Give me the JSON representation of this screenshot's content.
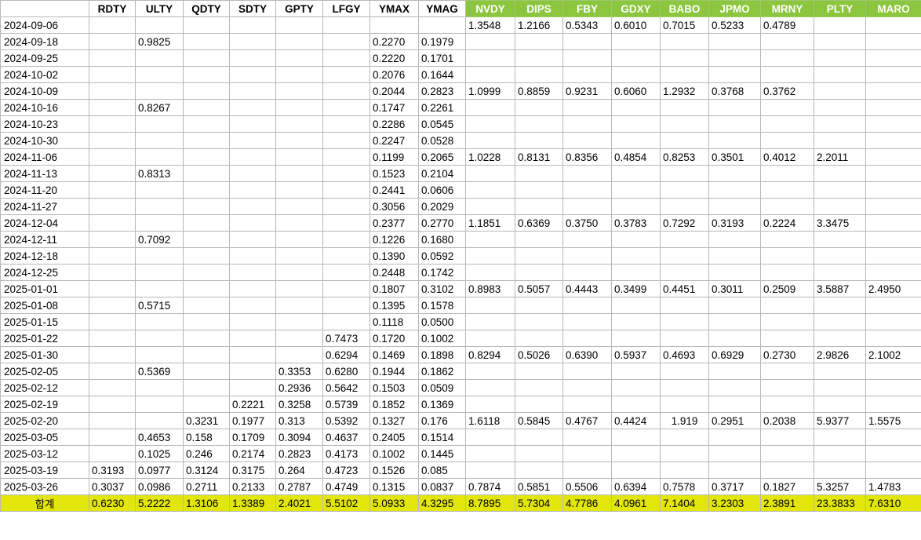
{
  "columns": [
    "",
    "RDTY",
    "ULTY",
    "QDTY",
    "SDTY",
    "GPTY",
    "LFGY",
    "YMAX",
    "YMAG",
    "NVDY",
    "DIPS",
    "FBY",
    "GDXY",
    "BABO",
    "JPMO",
    "MRNY",
    "PLTY",
    "MARO"
  ],
  "rows": [
    [
      "2024-09-06",
      "",
      "",
      "",
      "",
      "",
      "",
      "",
      "",
      "1.3548",
      "1.2166",
      "0.5343",
      "0.6010",
      "0.7015",
      "0.5233",
      "0.4789",
      "",
      ""
    ],
    [
      "2024-09-18",
      "",
      "0.9825",
      "",
      "",
      "",
      "",
      "0.2270",
      "0.1979",
      "",
      "",
      "",
      "",
      "",
      "",
      "",
      "",
      ""
    ],
    [
      "2024-09-25",
      "",
      "",
      "",
      "",
      "",
      "",
      "0.2220",
      "0.1701",
      "",
      "",
      "",
      "",
      "",
      "",
      "",
      "",
      ""
    ],
    [
      "2024-10-02",
      "",
      "",
      "",
      "",
      "",
      "",
      "0.2076",
      "0.1644",
      "",
      "",
      "",
      "",
      "",
      "",
      "",
      "",
      ""
    ],
    [
      "2024-10-09",
      "",
      "",
      "",
      "",
      "",
      "",
      "0.2044",
      "0.2823",
      "1.0999",
      "0.8859",
      "0.9231",
      "0.6060",
      "1.2932",
      "0.3768",
      "0.3762",
      "",
      ""
    ],
    [
      "2024-10-16",
      "",
      "0.8267",
      "",
      "",
      "",
      "",
      "0.1747",
      "0.2261",
      "",
      "",
      "",
      "",
      "",
      "",
      "",
      "",
      ""
    ],
    [
      "2024-10-23",
      "",
      "",
      "",
      "",
      "",
      "",
      "0.2286",
      "0.0545",
      "",
      "",
      "",
      "",
      "",
      "",
      "",
      "",
      ""
    ],
    [
      "2024-10-30",
      "",
      "",
      "",
      "",
      "",
      "",
      "0.2247",
      "0.0528",
      "",
      "",
      "",
      "",
      "",
      "",
      "",
      "",
      ""
    ],
    [
      "2024-11-06",
      "",
      "",
      "",
      "",
      "",
      "",
      "0.1199",
      "0.2065",
      "1.0228",
      "0.8131",
      "0.8356",
      "0.4854",
      "0.8253",
      "0.3501",
      "0.4012",
      "2.2011",
      ""
    ],
    [
      "2024-11-13",
      "",
      "0.8313",
      "",
      "",
      "",
      "",
      "0.1523",
      "0.2104",
      "",
      "",
      "",
      "",
      "",
      "",
      "",
      "",
      ""
    ],
    [
      "2024-11-20",
      "",
      "",
      "",
      "",
      "",
      "",
      "0.2441",
      "0.0606",
      "",
      "",
      "",
      "",
      "",
      "",
      "",
      "",
      ""
    ],
    [
      "2024-11-27",
      "",
      "",
      "",
      "",
      "",
      "",
      "0.3056",
      "0.2029",
      "",
      "",
      "",
      "",
      "",
      "",
      "",
      "",
      ""
    ],
    [
      "2024-12-04",
      "",
      "",
      "",
      "",
      "",
      "",
      "0.2377",
      "0.2770",
      "1.1851",
      "0.6369",
      "0.3750",
      "0.3783",
      "0.7292",
      "0.3193",
      "0.2224",
      "3.3475",
      ""
    ],
    [
      "2024-12-11",
      "",
      "0.7092",
      "",
      "",
      "",
      "",
      "0.1226",
      "0.1680",
      "",
      "",
      "",
      "",
      "",
      "",
      "",
      "",
      ""
    ],
    [
      "2024-12-18",
      "",
      "",
      "",
      "",
      "",
      "",
      "0.1390",
      "0.0592",
      "",
      "",
      "",
      "",
      "",
      "",
      "",
      "",
      ""
    ],
    [
      "2024-12-25",
      "",
      "",
      "",
      "",
      "",
      "",
      "0.2448",
      "0.1742",
      "",
      "",
      "",
      "",
      "",
      "",
      "",
      "",
      ""
    ],
    [
      "2025-01-01",
      "",
      "",
      "",
      "",
      "",
      "",
      "0.1807",
      "0.3102",
      "0.8983",
      "0.5057",
      "0.4443",
      "0.3499",
      "0.4451",
      "0.3011",
      "0.2509",
      "3.5887",
      "2.4950"
    ],
    [
      "2025-01-08",
      "",
      "0.5715",
      "",
      "",
      "",
      "",
      "0.1395",
      "0.1578",
      "",
      "",
      "",
      "",
      "",
      "",
      "",
      "",
      ""
    ],
    [
      "2025-01-15",
      "",
      "",
      "",
      "",
      "",
      "",
      "0.1118",
      "0.0500",
      "",
      "",
      "",
      "",
      "",
      "",
      "",
      "",
      ""
    ],
    [
      "2025-01-22",
      "",
      "",
      "",
      "",
      "",
      "0.7473",
      "0.1720",
      "0.1002",
      "",
      "",
      "",
      "",
      "",
      "",
      "",
      "",
      ""
    ],
    [
      "2025-01-30",
      "",
      "",
      "",
      "",
      "",
      "0.6294",
      "0.1469",
      "0.1898",
      "0.8294",
      "0.5026",
      "0.6390",
      "0.5937",
      "0.4693",
      "0.6929",
      "0.2730",
      "2.9826",
      "2.1002"
    ],
    [
      "2025-02-05",
      "",
      "0.5369",
      "",
      "",
      "0.3353",
      "0.6280",
      "0.1944",
      "0.1862",
      "",
      "",
      "",
      "",
      "",
      "",
      "",
      "",
      ""
    ],
    [
      "2025-02-12",
      "",
      "",
      "",
      "",
      "0.2936",
      "0.5642",
      "0.1503",
      "0.0509",
      "",
      "",
      "",
      "",
      "",
      "",
      "",
      "",
      ""
    ],
    [
      "2025-02-19",
      "",
      "",
      "",
      "0.2221",
      "0.3258",
      "0.5739",
      "0.1852",
      "0.1369",
      "",
      "",
      "",
      "",
      "",
      "",
      "",
      "",
      ""
    ],
    [
      "2025-02-20",
      "",
      "",
      "0.3231",
      "0.1977",
      "0.313",
      "0.5392",
      "0.1327",
      "0.176",
      "1.6118",
      "0.5845",
      "0.4767",
      "0.4424",
      "1.919",
      "0.2951",
      "0.2038",
      "5.9377",
      "1.5575"
    ],
    [
      "2025-03-05",
      "",
      "0.4653",
      "0.158",
      "0.1709",
      "0.3094",
      "0.4637",
      "0.2405",
      "0.1514",
      "",
      "",
      "",
      "",
      "",
      "",
      "",
      "",
      ""
    ],
    [
      "2025-03-12",
      "",
      "0.1025",
      "0.246",
      "0.2174",
      "0.2823",
      "0.4173",
      "0.1002",
      "0.1445",
      "",
      "",
      "",
      "",
      "",
      "",
      "",
      "",
      ""
    ],
    [
      "2025-03-19",
      "0.3193",
      "0.0977",
      "0.3124",
      "0.3175",
      "0.264",
      "0.4723",
      "0.1526",
      "0.085",
      "",
      "",
      "",
      "",
      "",
      "",
      "",
      "",
      ""
    ],
    [
      "2025-03-26",
      "0.3037",
      "0.0986",
      "0.2711",
      "0.2133",
      "0.2787",
      "0.4749",
      "0.1315",
      "0.0837",
      "0.7874",
      "0.5851",
      "0.5506",
      "0.6394",
      "0.7578",
      "0.3717",
      "0.1827",
      "5.3257",
      "1.4783"
    ]
  ],
  "total": [
    "합계",
    "0.6230",
    "5.2222",
    "1.3106",
    "1.3389",
    "2.4021",
    "5.5102",
    "5.0933",
    "4.3295",
    "8.7895",
    "5.7304",
    "4.7786",
    "4.0961",
    "7.1404",
    "3.2303",
    "2.3891",
    "23.3833",
    "7.6310"
  ],
  "colors": {
    "header_green": "#8cc63f",
    "total_yellow": "#e3e60a",
    "grid": "#b8b8b8",
    "divider_red": "#e07070"
  }
}
